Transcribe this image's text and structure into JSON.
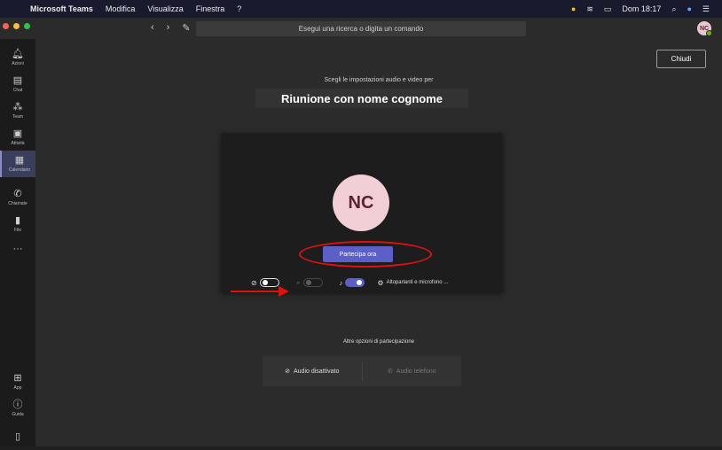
{
  "menubar": {
    "items": [
      "Microsoft Teams",
      "Modifica",
      "Visualizza",
      "Finestra",
      "?"
    ],
    "clock": "Dom 18:17"
  },
  "titlebar": {
    "search_placeholder": "Esegui una ricerca o digita un comando",
    "avatar_initials": "NC"
  },
  "sidebar": {
    "items": [
      {
        "label": "Azioni",
        "icon": "bell-icon"
      },
      {
        "label": "Chat",
        "icon": "chat-icon"
      },
      {
        "label": "Team",
        "icon": "team-icon"
      },
      {
        "label": "Attività",
        "icon": "bag-icon"
      },
      {
        "label": "Calendario",
        "icon": "calendar-icon",
        "active": true
      },
      {
        "label": "Chiamate",
        "icon": "phone-icon"
      },
      {
        "label": "File",
        "icon": "file-icon"
      },
      {
        "label": "",
        "icon": "more-icon"
      }
    ],
    "bottom": [
      {
        "label": "App",
        "icon": "apps-icon"
      },
      {
        "label": "Guida",
        "icon": "help-icon"
      }
    ]
  },
  "main": {
    "close_label": "Chiudi",
    "subtitle": "Scegli le impostazioni audio e video per",
    "meeting_title": "Riunione con nome cognome",
    "avatar_initials": "NC",
    "join_label": "Partecipa ora",
    "device_label": "Altoparlanti e microfono ...",
    "more_options_title": "Altre opzioni di partecipazione",
    "audio_off_label": "Audio disattivato",
    "phone_audio_label": "Audio telefono"
  },
  "colors": {
    "accent": "#5b5fc7",
    "highlight_ellipse": "#dd1111",
    "avatar_bg": "#f2cfd7"
  }
}
